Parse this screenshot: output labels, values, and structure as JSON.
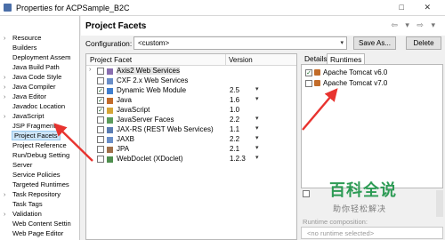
{
  "window": {
    "title": "Properties for ACPSample_B2C",
    "controls": "□ ✕"
  },
  "sidebar": {
    "items": [
      {
        "label": "Resource",
        "expander": "›"
      },
      {
        "label": "Builders",
        "expander": ""
      },
      {
        "label": "Deployment Assem",
        "expander": ""
      },
      {
        "label": "Java Build Path",
        "expander": ""
      },
      {
        "label": "Java Code Style",
        "expander": "›"
      },
      {
        "label": "Java Compiler",
        "expander": "›"
      },
      {
        "label": "Java Editor",
        "expander": "›"
      },
      {
        "label": "Javadoc Location",
        "expander": ""
      },
      {
        "label": "JavaScript",
        "expander": "›"
      },
      {
        "label": "JSP Fragment",
        "expander": ""
      },
      {
        "label": "Project Facets",
        "expander": ""
      },
      {
        "label": "Project Reference",
        "expander": ""
      },
      {
        "label": "Run/Debug Setting",
        "expander": ""
      },
      {
        "label": "Server",
        "expander": ""
      },
      {
        "label": "Service Policies",
        "expander": ""
      },
      {
        "label": "Targeted Runtimes",
        "expander": ""
      },
      {
        "label": "Task Repository",
        "expander": "›"
      },
      {
        "label": "Task Tags",
        "expander": ""
      },
      {
        "label": "Validation",
        "expander": "›"
      },
      {
        "label": "Web Content Settin",
        "expander": ""
      },
      {
        "label": "Web Page Editor",
        "expander": ""
      }
    ]
  },
  "header": {
    "title": "Project Facets",
    "nav": "⇦ ▾ ⇨ ▾"
  },
  "configuration": {
    "label": "Configuration:",
    "value": "<custom>",
    "save_as": "Save As...",
    "delete": "Delete"
  },
  "facets": {
    "col_facet": "Project Facet",
    "col_version": "Version",
    "rows": [
      {
        "name": "Axis2 Web Services",
        "version": "",
        "checked": "",
        "expander": "›",
        "dd": "",
        "color": "#8a6fb0"
      },
      {
        "name": "CXF 2.x Web Services",
        "version": "",
        "checked": "",
        "expander": "",
        "dd": "",
        "color": "#6a8fc8"
      },
      {
        "name": "Dynamic Web Module",
        "version": "2.5",
        "checked": "✓",
        "expander": "",
        "dd": "▾",
        "color": "#3f7fcf"
      },
      {
        "name": "Java",
        "version": "1.6",
        "checked": "✓",
        "expander": "",
        "dd": "▾",
        "color": "#c26c2a"
      },
      {
        "name": "JavaScript",
        "version": "1.0",
        "checked": "✓",
        "expander": "",
        "dd": "",
        "color": "#d6a637"
      },
      {
        "name": "JavaServer Faces",
        "version": "2.2",
        "checked": "",
        "expander": "",
        "dd": "▾",
        "color": "#5c9c5c"
      },
      {
        "name": "JAX-RS (REST Web Services)",
        "version": "1.1",
        "checked": "",
        "expander": "",
        "dd": "▾",
        "color": "#5b7db3"
      },
      {
        "name": "JAXB",
        "version": "2.2",
        "checked": "",
        "expander": "",
        "dd": "▾",
        "color": "#6a8fc8"
      },
      {
        "name": "JPA",
        "version": "2.1",
        "checked": "",
        "expander": "",
        "dd": "▾",
        "color": "#a0704a"
      },
      {
        "name": "WebDoclet (XDoclet)",
        "version": "1.2.3",
        "checked": "",
        "expander": "",
        "dd": "▾",
        "color": "#4f8f4f"
      }
    ]
  },
  "right": {
    "tab_details": "Details",
    "tab_runtimes": "Runtimes",
    "runtimes": [
      {
        "label": "Apache Tomcat v6.0",
        "checked": "✓"
      },
      {
        "label": "Apache Tomcat v7.0",
        "checked": ""
      }
    ],
    "runtime_composition_label": "Runtime composition:",
    "runtime_composition_value": "<no runtime selected>"
  },
  "watermark": {
    "line1": "百科全说",
    "line2": "助你轻松解决"
  },
  "colors": {
    "arrow": "#e8332f",
    "selection": "#cce4f7",
    "watermark": "#2d9b55"
  }
}
